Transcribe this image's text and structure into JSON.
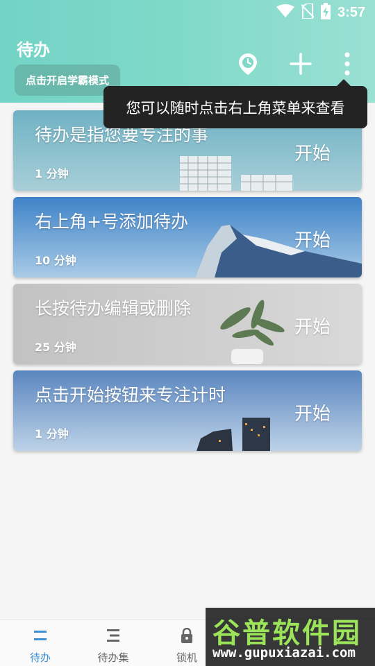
{
  "status_bar": {
    "time": "3:57"
  },
  "header": {
    "title": "待办",
    "mode_button": "点击开启学霸模式",
    "icons": [
      "clock-icon",
      "plus-icon",
      "more-vert-icon"
    ]
  },
  "tooltip": {
    "text": "您可以随时点击右上角菜单来查看"
  },
  "todos": [
    {
      "title": "待办是指您要专注的事",
      "duration": "1 分钟",
      "start": "开始"
    },
    {
      "title": "右上角+号添加待办",
      "duration": "10 分钟",
      "start": "开始"
    },
    {
      "title": "长按待办编辑或删除",
      "duration": "25 分钟",
      "start": "开始"
    },
    {
      "title": "点击开始按钮来专注计时",
      "duration": "1 分钟",
      "start": "开始"
    }
  ],
  "bottom_nav": [
    {
      "label": "待办",
      "icon": "todo-list-icon",
      "active": true
    },
    {
      "label": "待办集",
      "icon": "todo-set-icon",
      "active": false
    },
    {
      "label": "锁机",
      "icon": "lock-icon",
      "active": false
    }
  ],
  "watermark": {
    "brand": "谷普软件园",
    "url": "www.gupuxiazai.com"
  },
  "colors": {
    "header": "#7fd9c8",
    "accent": "#3f8fd0"
  }
}
